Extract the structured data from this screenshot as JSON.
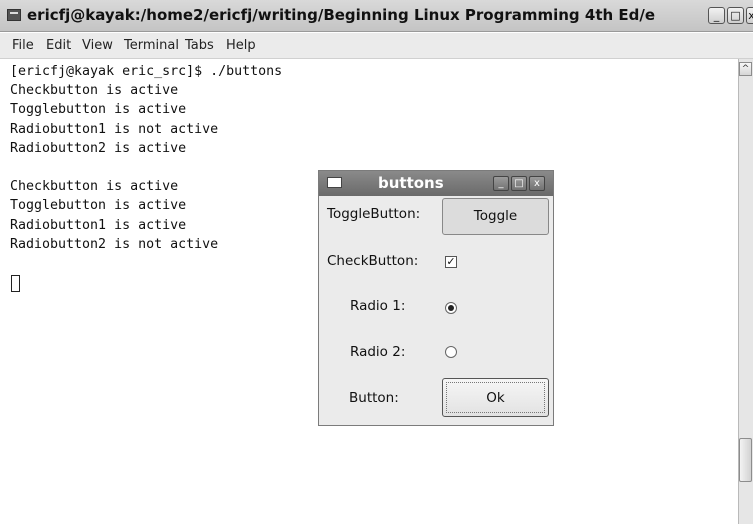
{
  "terminal": {
    "title": "ericfj@kayak:/home2/ericfj/writing/Beginning Linux Programming 4th Ed/e",
    "window_buttons": {
      "minimize": "_",
      "maximize": "□",
      "close": "x"
    },
    "menu": [
      "File",
      "Edit",
      "View",
      "Terminal",
      "Tabs",
      "Help"
    ],
    "output": "[ericfj@kayak eric_src]$ ./buttons\nCheckbutton is active\nTogglebutton is active\nRadiobutton1 is not active\nRadiobutton2 is active\n\nCheckbutton is active\nTogglebutton is active\nRadiobutton1 is active\nRadiobutton2 is not active",
    "scroll_up": "^"
  },
  "dialog": {
    "title": "buttons",
    "window_buttons": {
      "minimize": "_",
      "maximize": "□",
      "close": "x"
    },
    "toggle_label": "ToggleButton:",
    "toggle_button": "Toggle",
    "check_label": "CheckButton:",
    "check_mark": "✓",
    "checked": true,
    "radio1_label": "Radio 1:",
    "radio1_selected": true,
    "radio2_label": "Radio 2:",
    "radio2_selected": false,
    "button_label": "Button:",
    "ok_button": "Ok"
  }
}
